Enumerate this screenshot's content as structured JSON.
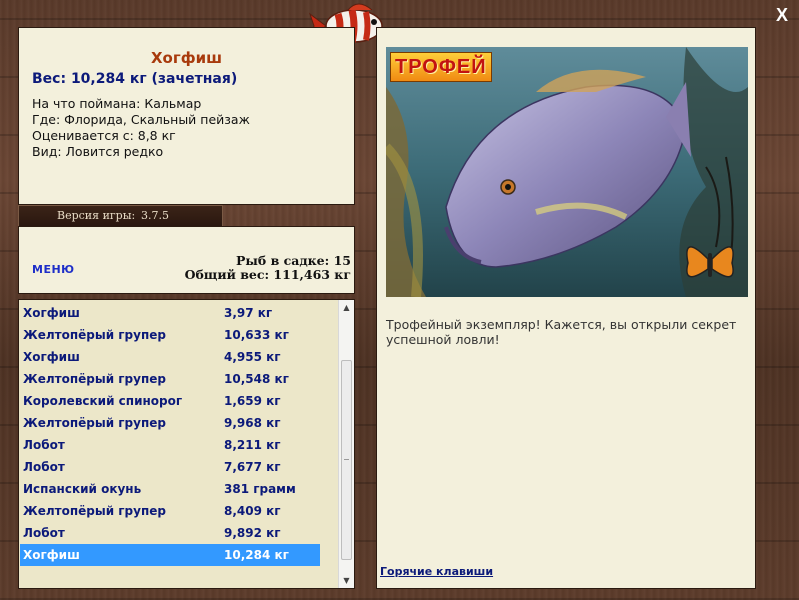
{
  "window": {
    "close_label": "X"
  },
  "catch_info": {
    "fish_name": "Хогфиш",
    "weight_line": "Вес: 10,284 кг (зачетная)",
    "bait_line": "На что поймана: Кальмар",
    "location_line": "Где: Флорида, Скальный пейзаж",
    "scored_line": "Оценивается с: 8,8 кг",
    "rarity_line": "Вид: Ловится редко"
  },
  "version": {
    "label": "Версия игры:",
    "value": "3.7.5"
  },
  "stats": {
    "menu_label": "МЕНЮ",
    "fish_count_line": "Рыб в садке: 15",
    "total_weight_line": "Общий вес: 111,463 кг"
  },
  "catch_list": [
    {
      "name": "Хогфиш",
      "weight": "3,97 кг"
    },
    {
      "name": "Желтопёрый групер",
      "weight": "10,633 кг"
    },
    {
      "name": "Хогфиш",
      "weight": "4,955 кг"
    },
    {
      "name": "Желтопёрый групер",
      "weight": "10,548 кг"
    },
    {
      "name": "Королевский спинорог",
      "weight": "1,659 кг"
    },
    {
      "name": "Желтопёрый групер",
      "weight": "9,968 кг"
    },
    {
      "name": "Лобот",
      "weight": "8,211 кг"
    },
    {
      "name": "Лобот",
      "weight": "7,677 кг"
    },
    {
      "name": "Испанский окунь",
      "weight": "381 грамм"
    },
    {
      "name": "Желтопёрый групер",
      "weight": "8,409 кг"
    },
    {
      "name": "Лобот",
      "weight": "9,892 кг"
    },
    {
      "name": "Хогфиш",
      "weight": "10,284 кг"
    }
  ],
  "selected_index": 11,
  "detail": {
    "trophy_badge": "ТРОФЕЙ",
    "description": "Трофейный экземпляр! Кажется, вы открыли секрет успешной ловли!",
    "hotkeys_link": "Горячие клавиши"
  },
  "colors": {
    "title_accent": "#a83a0c",
    "link_blue": "#0c1a7a",
    "selection": "#3399ff",
    "panel_bg": "#f3f0dc"
  }
}
